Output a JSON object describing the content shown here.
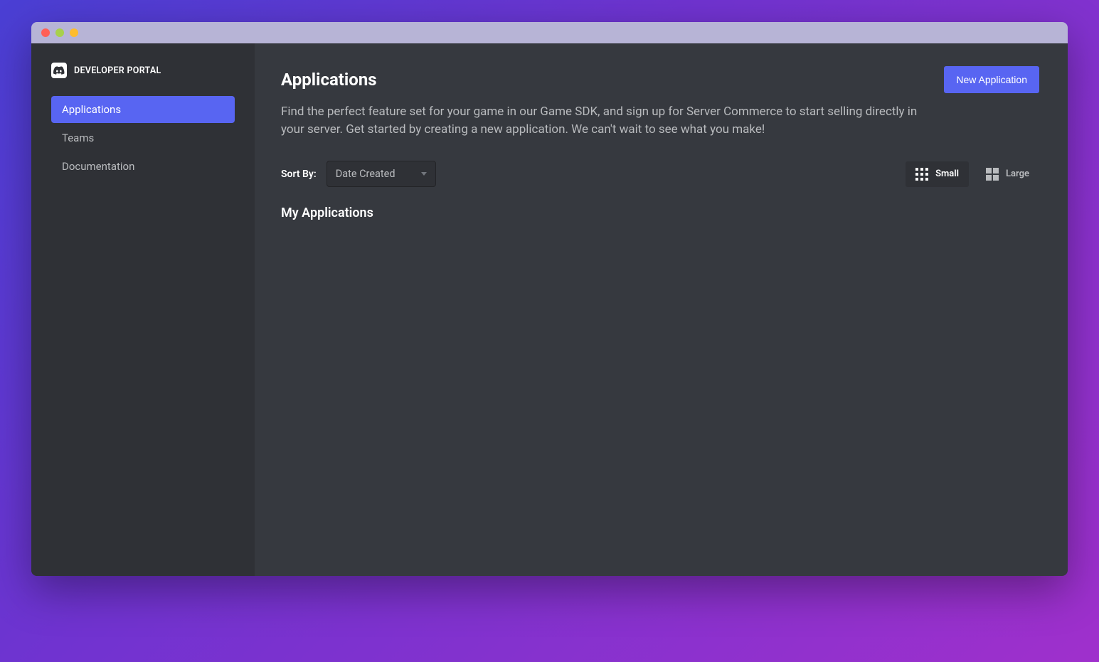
{
  "brand": {
    "label": "DEVELOPER PORTAL"
  },
  "sidebar": {
    "items": [
      {
        "label": "Applications"
      },
      {
        "label": "Teams"
      },
      {
        "label": "Documentation"
      }
    ]
  },
  "header": {
    "title": "Applications",
    "new_button": "New Application"
  },
  "description": "Find the perfect feature set for your game in our Game SDK, and sign up for Server Commerce to start selling directly in your server. Get started by creating a new application. We can't wait to see what you make!",
  "sort": {
    "label": "Sort By:",
    "selected": "Date Created"
  },
  "view": {
    "small": "Small",
    "large": "Large"
  },
  "section_title": "My Applications"
}
